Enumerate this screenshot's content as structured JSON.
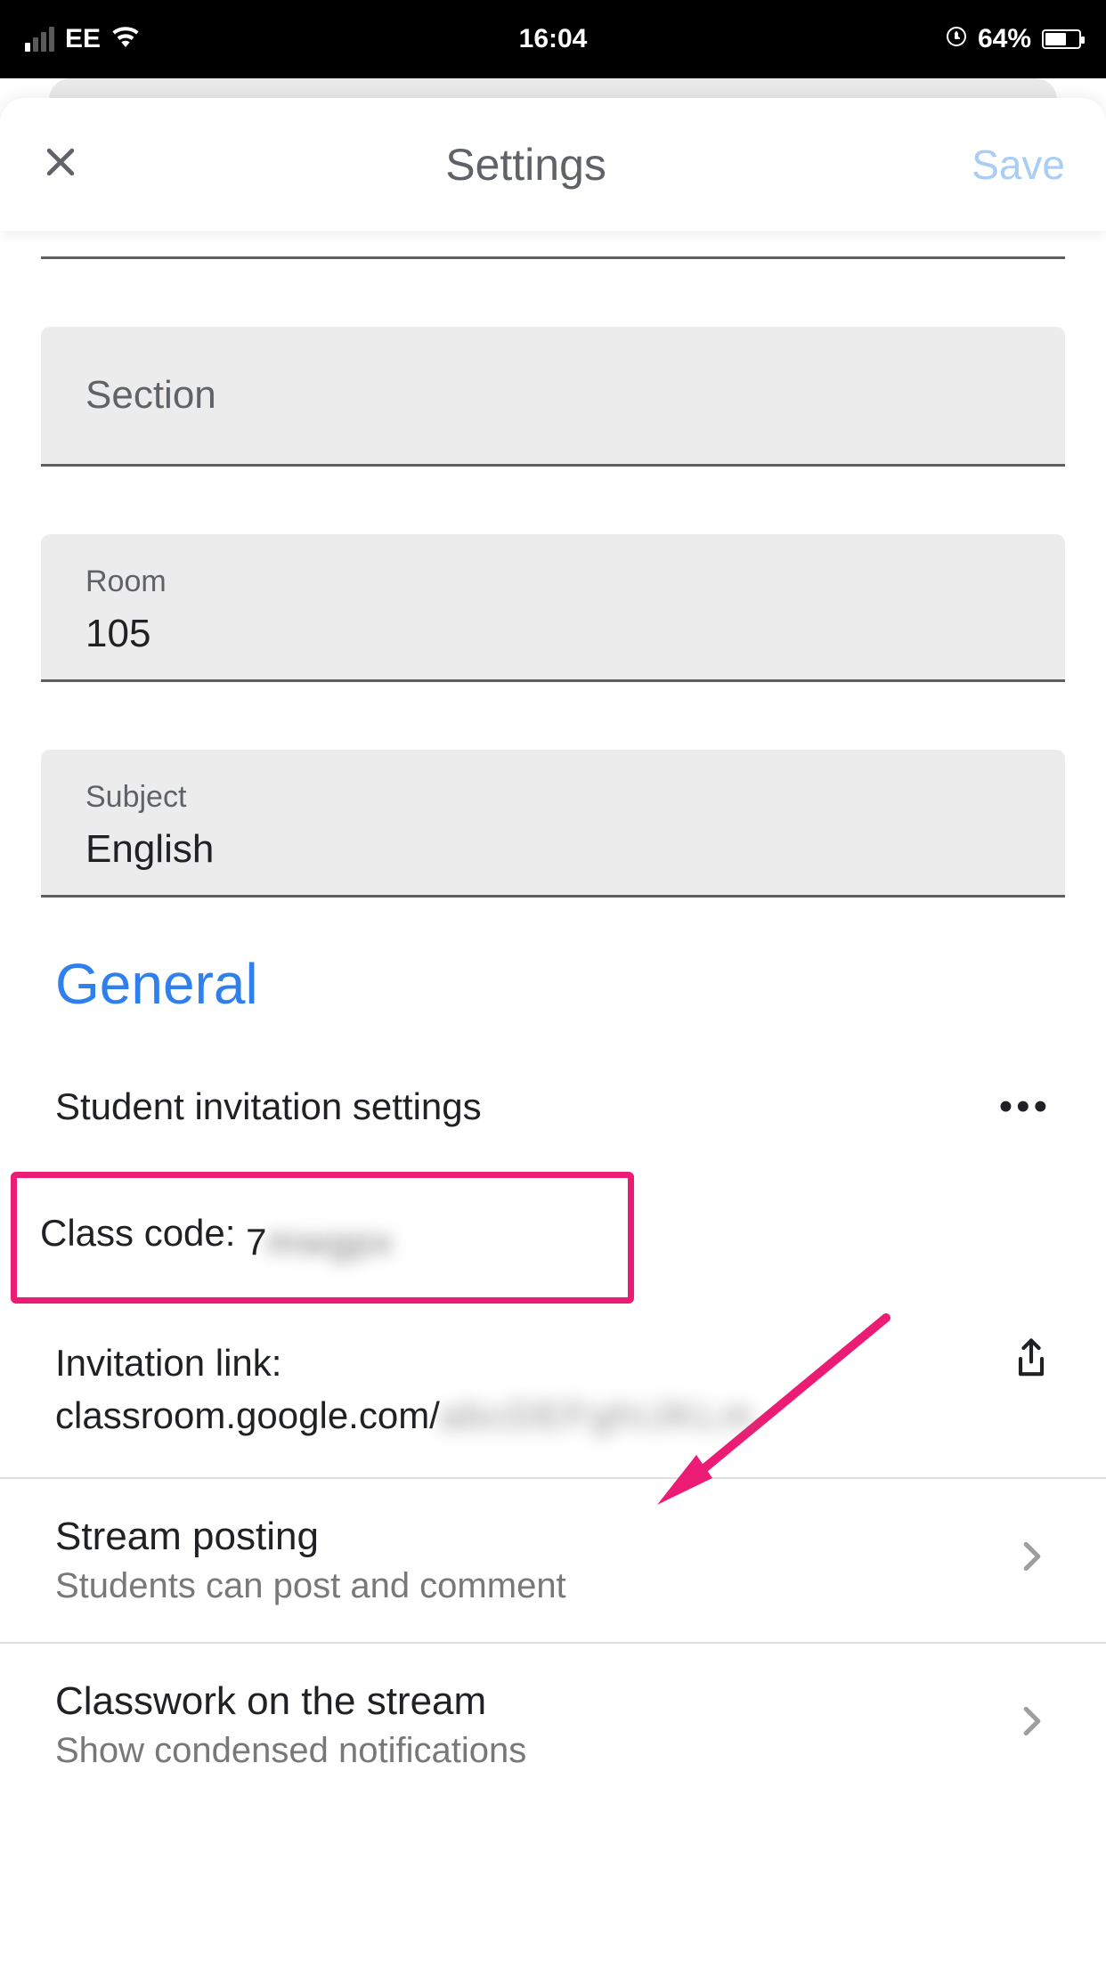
{
  "status": {
    "carrier": "EE",
    "time": "16:04",
    "battery_pct": "64%"
  },
  "header": {
    "title": "Settings",
    "save_label": "Save"
  },
  "fields": {
    "section_placeholder": "Section",
    "room_label": "Room",
    "room_value": "105",
    "subject_label": "Subject",
    "subject_value": "English"
  },
  "general": {
    "heading": "General",
    "invitation_settings_label": "Student invitation settings",
    "class_code_label": "Class code: ",
    "class_code_value": "7▇▇▇▇",
    "invitation_link_label": "Invitation link:",
    "invitation_link_value": "classroom.google.com/▇▇▇▇▇▇▇▇▇▇▇",
    "stream_posting_title": "Stream posting",
    "stream_posting_sub": "Students can post and comment",
    "classwork_title": "Classwork on the stream",
    "classwork_sub": "Show condensed notifications"
  }
}
